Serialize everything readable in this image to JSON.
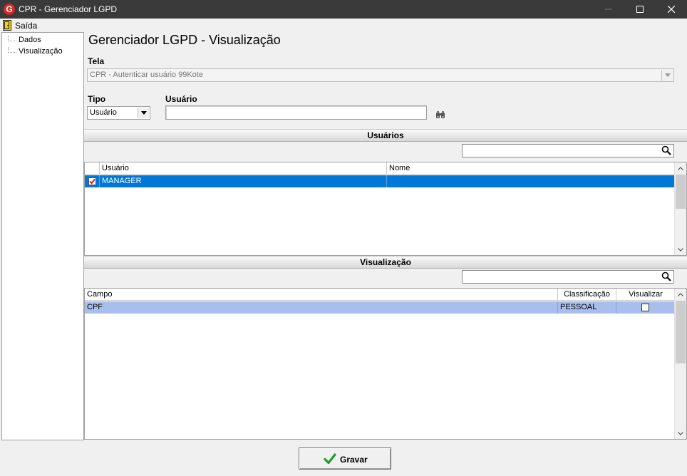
{
  "window": {
    "title": "CPR - Gerenciador LGPD",
    "logo_letter": "G"
  },
  "menu": {
    "exit_label": "Saída"
  },
  "tree": {
    "items": [
      "Dados",
      "Visualização"
    ]
  },
  "page": {
    "title": "Gerenciador LGPD - Visualização"
  },
  "form": {
    "tela_label": "Tela",
    "tela_value": "CPR - Autenticar usuário 99Kote",
    "tipo_label": "Tipo",
    "tipo_value": "Usuário",
    "usuario_label": "Usuário",
    "usuario_value": ""
  },
  "usuarios_section": {
    "title": "Usuários",
    "search_value": "",
    "columns": [
      "Usuário",
      "Nome"
    ],
    "rows": [
      {
        "checked": true,
        "usuario": "MANAGER",
        "nome": ""
      }
    ]
  },
  "visualizacao_section": {
    "title": "Visualização",
    "search_value": "",
    "columns": [
      "Campo",
      "Classificação",
      "Visualizar"
    ],
    "rows": [
      {
        "campo": "CPF",
        "classificacao": "PESSOAL",
        "visualizar": false
      }
    ]
  },
  "footer": {
    "save_label": "Gravar"
  },
  "colors": {
    "selected_row": "#0078d7",
    "secondary_row": "#a8bfeb",
    "titlebar": "#3a3a3a",
    "check_green": "#1f9e2f"
  },
  "icons": {
    "app": "app-logo-icon",
    "exit": "exit-door-icon",
    "search": "search-icon",
    "binoculars": "binoculars-icon",
    "save": "checkmark-icon"
  }
}
